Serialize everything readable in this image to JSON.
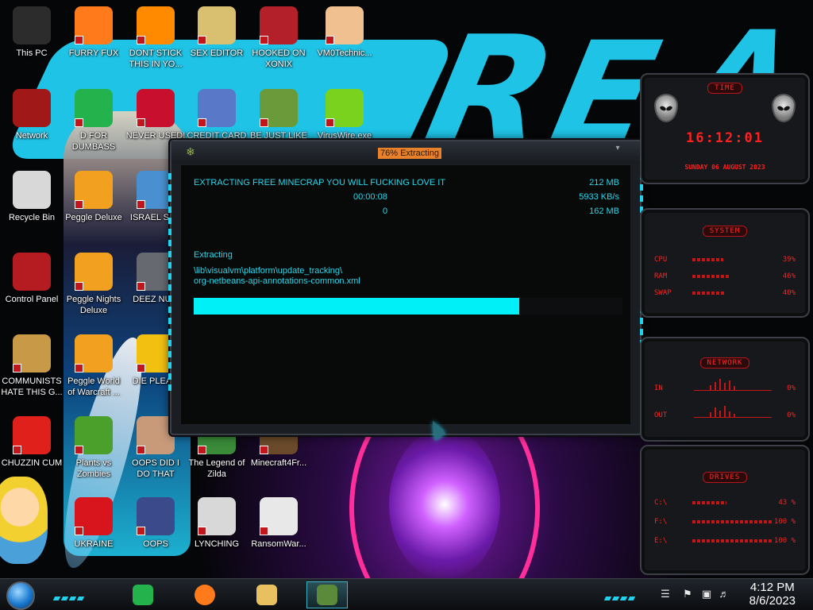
{
  "desktop_icons": [
    {
      "id": "this-pc",
      "label": "This PC",
      "icon": "computer-icon",
      "color": "#2c2c2c"
    },
    {
      "id": "furry-fux",
      "label": "FURRY FUX",
      "icon": "firefox-icon",
      "color": "#ff7a1a"
    },
    {
      "id": "dont-stick",
      "label": "DONT STICK THIS IN YO...",
      "icon": "vlc-cone-icon",
      "color": "#ff8a00"
    },
    {
      "id": "sex-editor",
      "label": "SEX EDITOR",
      "icon": "hex-editor-icon",
      "color": "#d8c070"
    },
    {
      "id": "hooked-on-xonix",
      "label": "HOOKED ON XONIX",
      "icon": "xonix-game-icon",
      "color": "#b3202a"
    },
    {
      "id": "vm0technic",
      "label": "VM0Technic...",
      "icon": "doctor-icon",
      "color": "#f0c090"
    },
    {
      "id": "network",
      "label": "Network",
      "icon": "network-icon",
      "color": "#a01818"
    },
    {
      "id": "d-for-dumbass",
      "label": "D FOR DUMBASS",
      "icon": "notes-icon",
      "color": "#23b24b"
    },
    {
      "id": "never-used",
      "label": "NEVER USED!",
      "icon": "devcpp-icon",
      "color": "#c8102e"
    },
    {
      "id": "credit-card",
      "label": "CREDIT CARD",
      "icon": "credit-card-icon",
      "color": "#5a78c8"
    },
    {
      "id": "be-just-like",
      "label": "BE JUST LIKE",
      "icon": "elf-icon",
      "color": "#6a9a3a"
    },
    {
      "id": "viruswire",
      "label": "VirusWire.exe",
      "icon": "lime-icon",
      "color": "#7ad21e"
    },
    {
      "id": "recycle-bin",
      "label": "Recycle Bin",
      "icon": "recycle-bin-icon",
      "color": "#d8d8d8"
    },
    {
      "id": "peggle-deluxe",
      "label": "Peggle Deluxe",
      "icon": "peggle-icon",
      "color": "#f2a020"
    },
    {
      "id": "israel-sp",
      "label": "ISRAEL SP...",
      "icon": "folder-icon",
      "color": "#4a90d0"
    },
    {
      "id": "control-panel",
      "label": "Control Panel",
      "icon": "control-panel-icon",
      "color": "#b41c22"
    },
    {
      "id": "peggle-nights",
      "label": "Peggle Nights Deluxe",
      "icon": "peggle-icon",
      "color": "#f2a020"
    },
    {
      "id": "deez-nu",
      "label": "DEEZ NU...",
      "icon": "stack-icon",
      "color": "#666a70"
    },
    {
      "id": "communists",
      "label": "COMMUNISTS HATE THIS G...",
      "icon": "money-bag-icon",
      "color": "#c89a48"
    },
    {
      "id": "peggle-world",
      "label": "Peggle World of Warcraft ...",
      "icon": "peggle-icon",
      "color": "#f2a020"
    },
    {
      "id": "die-plea",
      "label": "DIE PLEA...",
      "icon": "de-icon",
      "color": "#f2c010"
    },
    {
      "id": "chuzzin-cum",
      "label": "CHUZZIN CUM",
      "icon": "chuzzle-icon",
      "color": "#e0201a"
    },
    {
      "id": "plants-vs-zombies",
      "label": "Plants vs Zombies",
      "icon": "plant-icon",
      "color": "#4aa02a"
    },
    {
      "id": "oops-did-i",
      "label": "OOPS DID I DO THAT",
      "icon": "portrait-icon",
      "color": "#c89a7a"
    },
    {
      "id": "legend-of-zilda",
      "label": "The Legend of Zilda",
      "icon": "zelda-icon",
      "color": "#3a8a3a"
    },
    {
      "id": "minecraft4fr",
      "label": "Minecraft4Fr...",
      "icon": "minecraft-icon",
      "color": "#6a4a2a"
    },
    {
      "id": "ukraine",
      "label": "UKRAINE",
      "icon": "radiation-icon",
      "color": "#d8141c"
    },
    {
      "id": "oops",
      "label": "OOPS",
      "icon": "shoe-icon",
      "color": "#3a4a8a"
    },
    {
      "id": "lynching",
      "label": "LYNCHING",
      "icon": "noose-icon",
      "color": "#d8d8d8"
    },
    {
      "id": "ransomwar",
      "label": "RansomWar...",
      "icon": "skull-icon",
      "color": "#e8e8e8"
    }
  ],
  "wallpaper": {
    "letters": [
      "R",
      "E",
      "A"
    ],
    "accent": "#1fc3e6"
  },
  "extract_window": {
    "title": "76% Extracting",
    "heading": "EXTRACTING FREE MINECRAP YOU WILL FUCKING LOVE IT",
    "total_size": "212 MB",
    "elapsed": "00:00:08",
    "speed": "5933 KB/s",
    "errors": "0",
    "processed": "162 MB",
    "status_label": "Extracting",
    "current_path": "\\lib\\visualvm\\platform\\update_tracking\\",
    "current_file": "org-netbeans-api-annotations-common.xml",
    "progress_percent": 76
  },
  "gadgets": {
    "time": {
      "title": "TIME",
      "clock": "16:12:01",
      "date": "SUNDAY 06 AUGUST 2023"
    },
    "system": {
      "title": "SYSTEM",
      "rows": [
        {
          "label": "CPU",
          "value": "39%",
          "level": 39
        },
        {
          "label": "RAM",
          "value": "46%",
          "level": 46
        },
        {
          "label": "SWAP",
          "value": "40%",
          "level": 40
        }
      ]
    },
    "network": {
      "title": "NETWORK",
      "rows": [
        {
          "label": "IN",
          "value": "0%"
        },
        {
          "label": "OUT",
          "value": "0%"
        }
      ]
    },
    "drives": {
      "title": "DRIVES",
      "rows": [
        {
          "label": "C:\\",
          "value": "43 %",
          "level": 43
        },
        {
          "label": "F:\\",
          "value": "100 %",
          "level": 100
        },
        {
          "label": "E:\\",
          "value": "100 %",
          "level": 100
        }
      ]
    },
    "red": "#ff2020"
  },
  "taskbar": {
    "pinned": [
      {
        "id": "notes",
        "icon": "notes-icon",
        "color": "#23b24b"
      },
      {
        "id": "firefox",
        "icon": "firefox-icon",
        "color": "#ff7a1a"
      },
      {
        "id": "explorer",
        "icon": "folder-icon",
        "color": "#e8c060"
      },
      {
        "id": "minecraft",
        "icon": "minecraft-icon",
        "color": "#5a8a3a"
      }
    ],
    "time": "4:12 PM",
    "date": "8/6/2023",
    "accent": "#1fd2ee"
  }
}
